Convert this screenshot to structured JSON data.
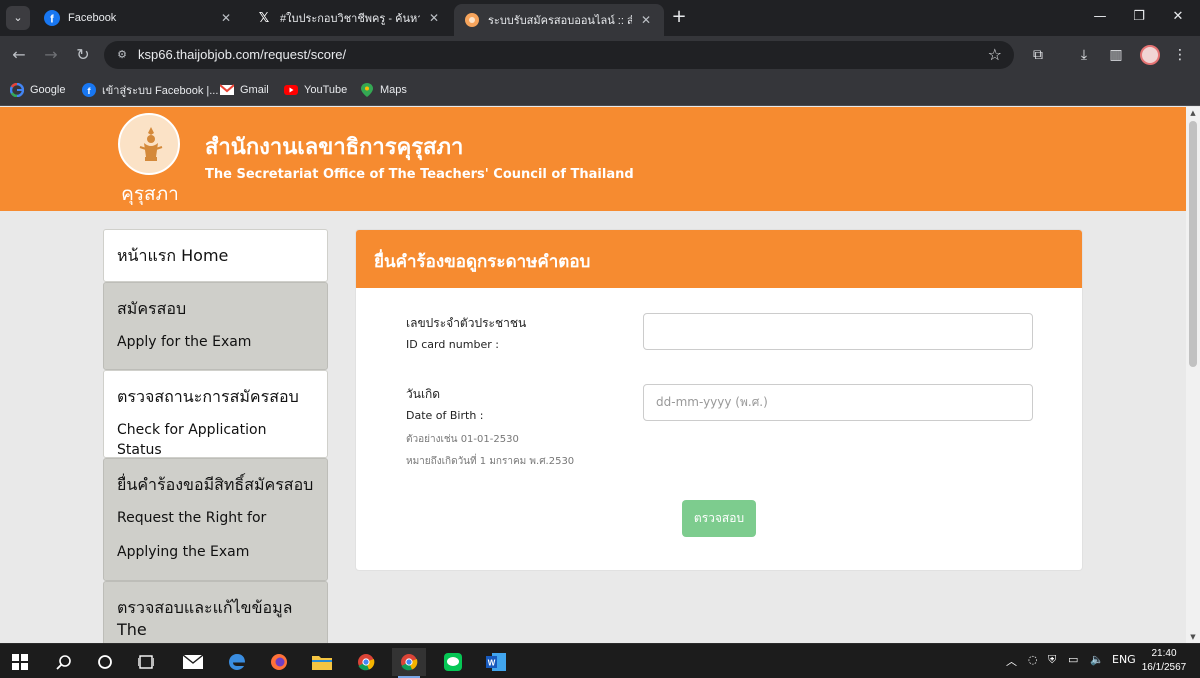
{
  "browser": {
    "tabs": [
      {
        "title": "Facebook",
        "icon": "facebook-icon",
        "active": false
      },
      {
        "title": "#ใบประกอบวิชาชีพครู - ค้นหา / X",
        "icon": "x-icon",
        "active": false
      },
      {
        "title": "ระบบรับสมัครสอบออนไลน์ :: สำนักงาน",
        "icon": "ksp-favicon",
        "active": true
      }
    ],
    "url": "ksp66.thaijobjob.com/request/score/",
    "bookmarks": [
      {
        "label": "Google",
        "icon": "google-icon"
      },
      {
        "label": "เข้าสู่ระบบ Facebook |...",
        "icon": "facebook-icon"
      },
      {
        "label": "Gmail",
        "icon": "gmail-icon"
      },
      {
        "label": "YouTube",
        "icon": "youtube-icon"
      },
      {
        "label": "Maps",
        "icon": "maps-icon"
      }
    ]
  },
  "header": {
    "logo_text": "คุรุสภา",
    "org_name_th": "สำนักงานเลขาธิการคุรุสภา",
    "org_name_en": "The Secretariat Office of The Teachers' Council of Thailand"
  },
  "sidebar": {
    "items": [
      {
        "lines": [
          "หน้าแรก  Home"
        ]
      },
      {
        "lines": [
          "สมัครสอบ",
          "Apply for the Exam"
        ]
      },
      {
        "lines": [
          "ตรวจสถานะการสมัครสอบ",
          "Check for Application Status"
        ]
      },
      {
        "lines": [
          "ยื่นคำร้องขอมีสิทธิ์สมัครสอบ",
          "Request the Right for",
          "Applying the Exam"
        ]
      },
      {
        "lines": [
          "ตรวจสอบและแก้ไขข้อมูล The",
          "..."
        ]
      }
    ]
  },
  "form": {
    "title": "ยื่นคำร้องขอดูกระดาษคำตอบ",
    "id_label_th": "เลขประจำตัวประชาชน",
    "id_label_en": "ID card number :",
    "id_value": "",
    "dob_label_th": "วันเกิด",
    "dob_label_en": "Date of Birth :",
    "dob_hint_1": "ตัวอย่างเช่น  01-01-2530",
    "dob_hint_2": "หมายถึงเกิดวันที่ 1 มกราคม พ.ศ.2530",
    "dob_placeholder": "dd-mm-yyyy (พ.ศ.)",
    "submit_label": "ตรวจสอบ"
  },
  "taskbar": {
    "language": "ENG",
    "time": "21:40",
    "date": "16/1/2567"
  },
  "colors": {
    "brand_orange": "#f68b30",
    "sidebar_grey": "#cfcfca",
    "submit_green": "#7dcc8e",
    "chrome_dark": "#35363a"
  }
}
